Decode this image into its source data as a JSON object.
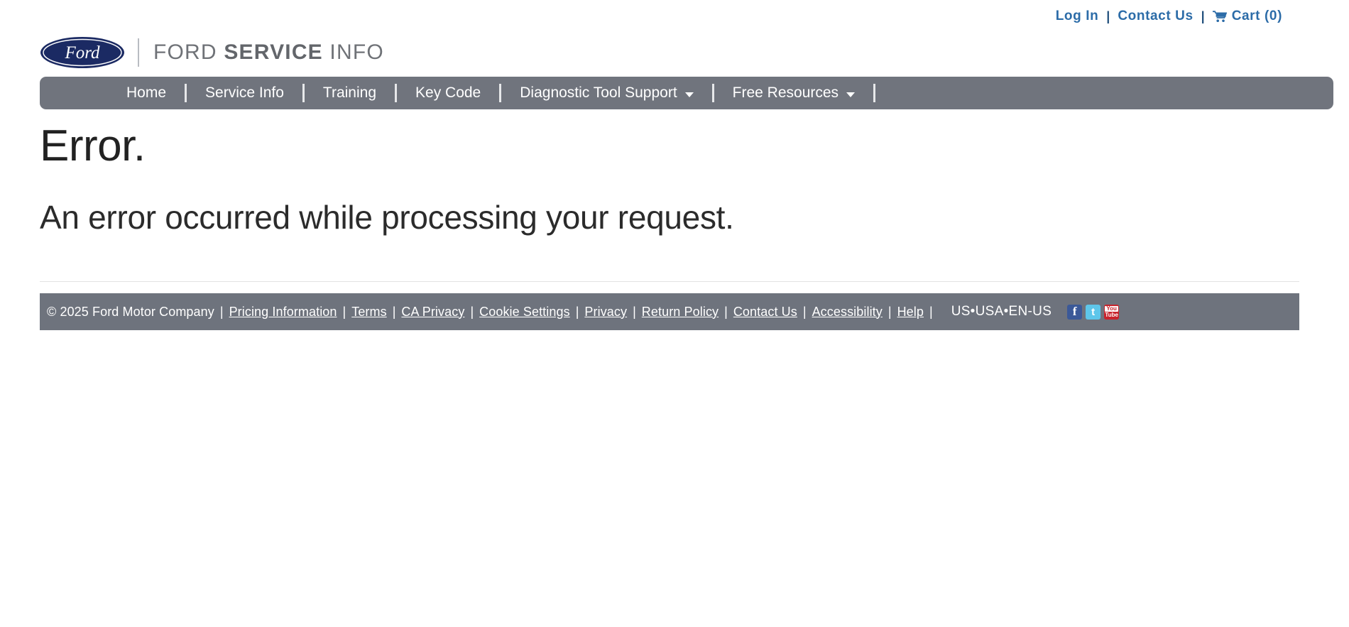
{
  "utility": {
    "login_label": "Log In",
    "contact_label": "Contact Us",
    "cart_label": "Cart (0)",
    "separator": "|",
    "cart_icon": "shopping-cart-icon",
    "link_color": "#2c6ca8"
  },
  "logo": {
    "brand_mark": "ford-oval-logo",
    "brand_word": "Ford",
    "text_part1": "FORD ",
    "text_part2": "SERVICE",
    "text_part3": " INFO",
    "oval_color": "#1b2a63",
    "text_color": "#6f7277"
  },
  "nav": {
    "background": "#70747d",
    "items": [
      {
        "label": "Home",
        "has_dropdown": false
      },
      {
        "label": "Service Info",
        "has_dropdown": false
      },
      {
        "label": "Training",
        "has_dropdown": false
      },
      {
        "label": "Key Code",
        "has_dropdown": false
      },
      {
        "label": "Diagnostic Tool Support",
        "has_dropdown": true
      },
      {
        "label": "Free Resources",
        "has_dropdown": true
      }
    ]
  },
  "main": {
    "title": "Error.",
    "message": "An error occurred while processing your request."
  },
  "footer": {
    "background": "#6e737d",
    "copyright": "© 2025 Ford Motor Company",
    "separator": "|",
    "links": [
      "Pricing Information",
      "Terms",
      "CA Privacy",
      "Cookie Settings",
      "Privacy",
      "Return Policy",
      "Contact Us",
      "Accessibility",
      "Help"
    ],
    "locale": "US•USA•EN-US",
    "social": [
      {
        "name": "facebook-icon",
        "glyph": "f",
        "color": "#3b5998"
      },
      {
        "name": "twitter-icon",
        "glyph": "t",
        "color": "#5ec6ea"
      },
      {
        "name": "youtube-icon",
        "glyph_top": "You",
        "glyph_bottom": "Tube",
        "color": "#c8232c"
      }
    ]
  }
}
